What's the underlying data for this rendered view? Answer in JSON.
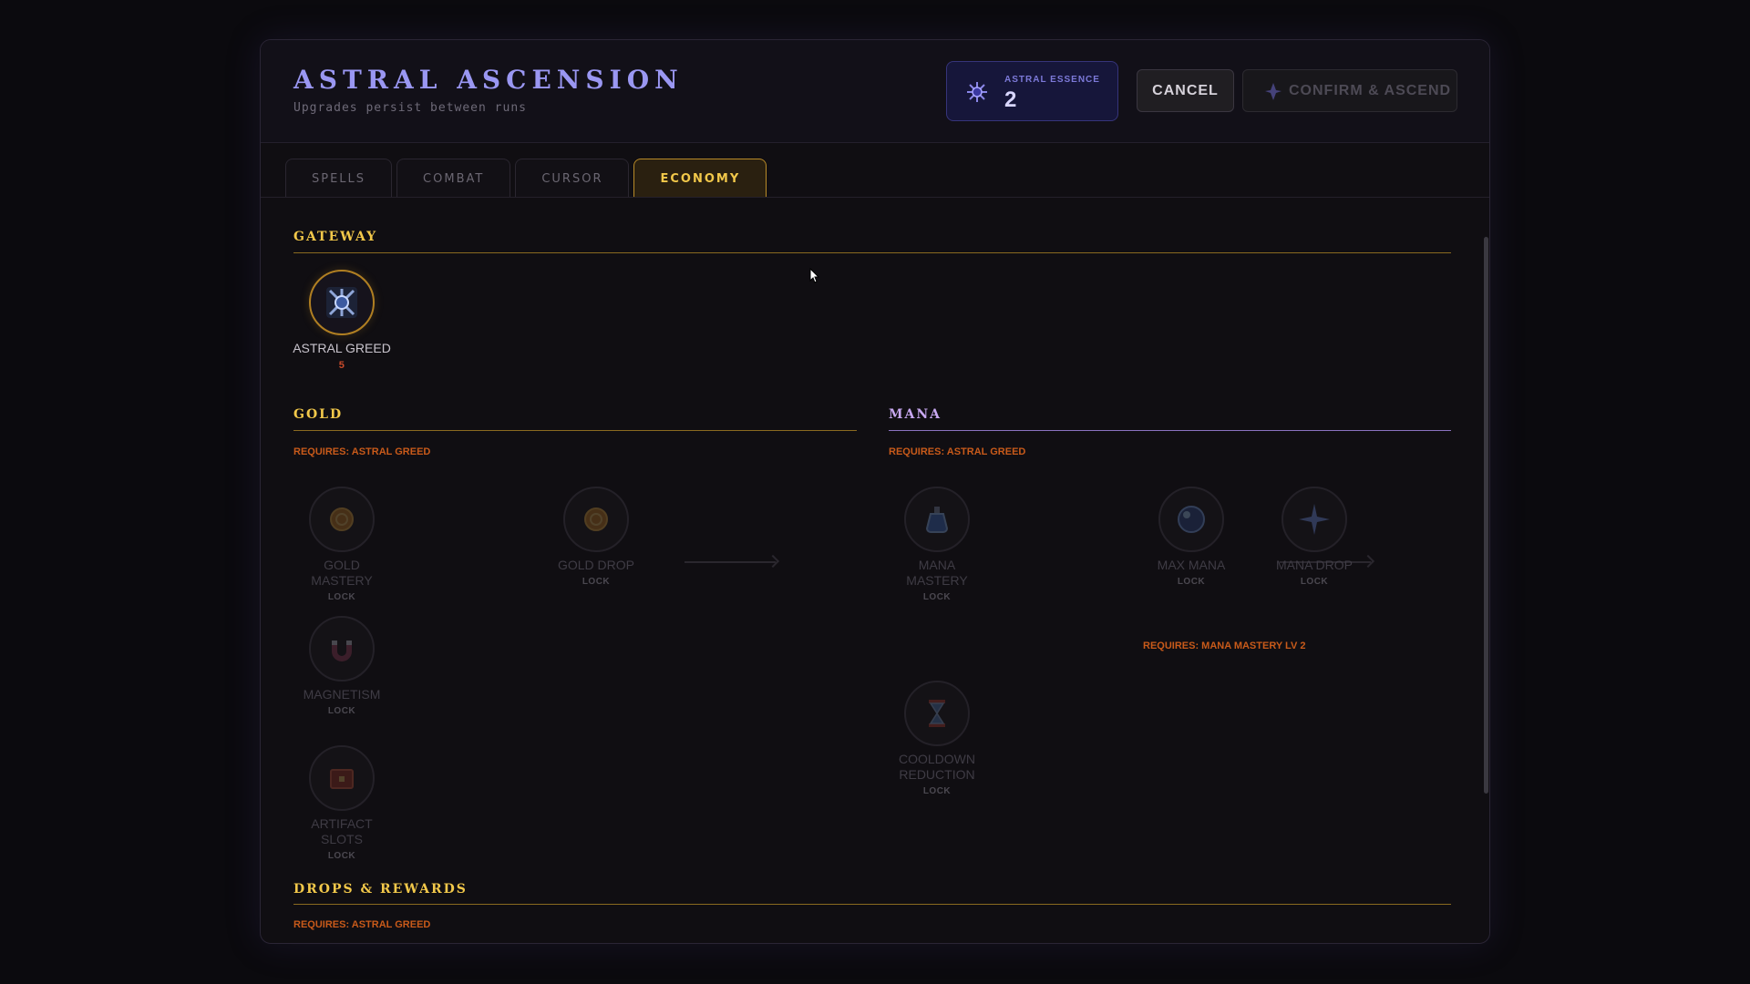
{
  "header": {
    "title": "ASTRAL ASCENSION",
    "subtitle": "Upgrades persist between runs",
    "essence_label": "ASTRAL ESSENCE",
    "essence_value": "2",
    "cancel_label": "CANCEL",
    "confirm_label": "CONFIRM & ASCEND"
  },
  "tabs": [
    {
      "label": "SPELLS",
      "active": false
    },
    {
      "label": "COMBAT",
      "active": false
    },
    {
      "label": "CURSOR",
      "active": false
    },
    {
      "label": "ECONOMY",
      "active": true
    }
  ],
  "sections": {
    "gateway": {
      "title": "GATEWAY",
      "node": {
        "name": "ASTRAL GREED",
        "status": "5",
        "icon": "astral-greed-icon"
      }
    },
    "gold": {
      "title": "GOLD",
      "requires": "REQUIRES: ASTRAL GREED",
      "nodes": [
        {
          "name": "GOLD MASTERY",
          "status": "LOCK",
          "icon": "gold-coin-icon"
        },
        {
          "name": "GOLD DROP",
          "status": "LOCK",
          "icon": "gold-coin-icon"
        },
        {
          "name": "MAGNETISM",
          "status": "LOCK",
          "icon": "magnet-icon"
        },
        {
          "name": "ARTIFACT SLOTS",
          "status": "LOCK",
          "icon": "chest-icon"
        }
      ]
    },
    "mana": {
      "title": "MANA",
      "requires": "REQUIRES: ASTRAL GREED",
      "nodes": [
        {
          "name": "MANA MASTERY",
          "status": "LOCK",
          "icon": "potion-icon"
        },
        {
          "name": "MAX MANA",
          "status": "LOCK",
          "icon": "orb-icon"
        },
        {
          "name": "MANA DROP",
          "status": "LOCK",
          "icon": "sparkle-icon"
        },
        {
          "name": "COOLDOWN REDUCTION",
          "status": "LOCK",
          "icon": "hourglass-icon"
        }
      ],
      "sub_requires": "REQUIRES: MANA MASTERY LV 2"
    },
    "drops": {
      "title": "DROPS & REWARDS",
      "requires": "REQUIRES: ASTRAL GREED"
    }
  },
  "colors": {
    "gold_accent": "#f2c84a",
    "mana_accent": "#c8a8f0",
    "title_color": "#9a97f2",
    "requires_color": "#c85a1a"
  }
}
